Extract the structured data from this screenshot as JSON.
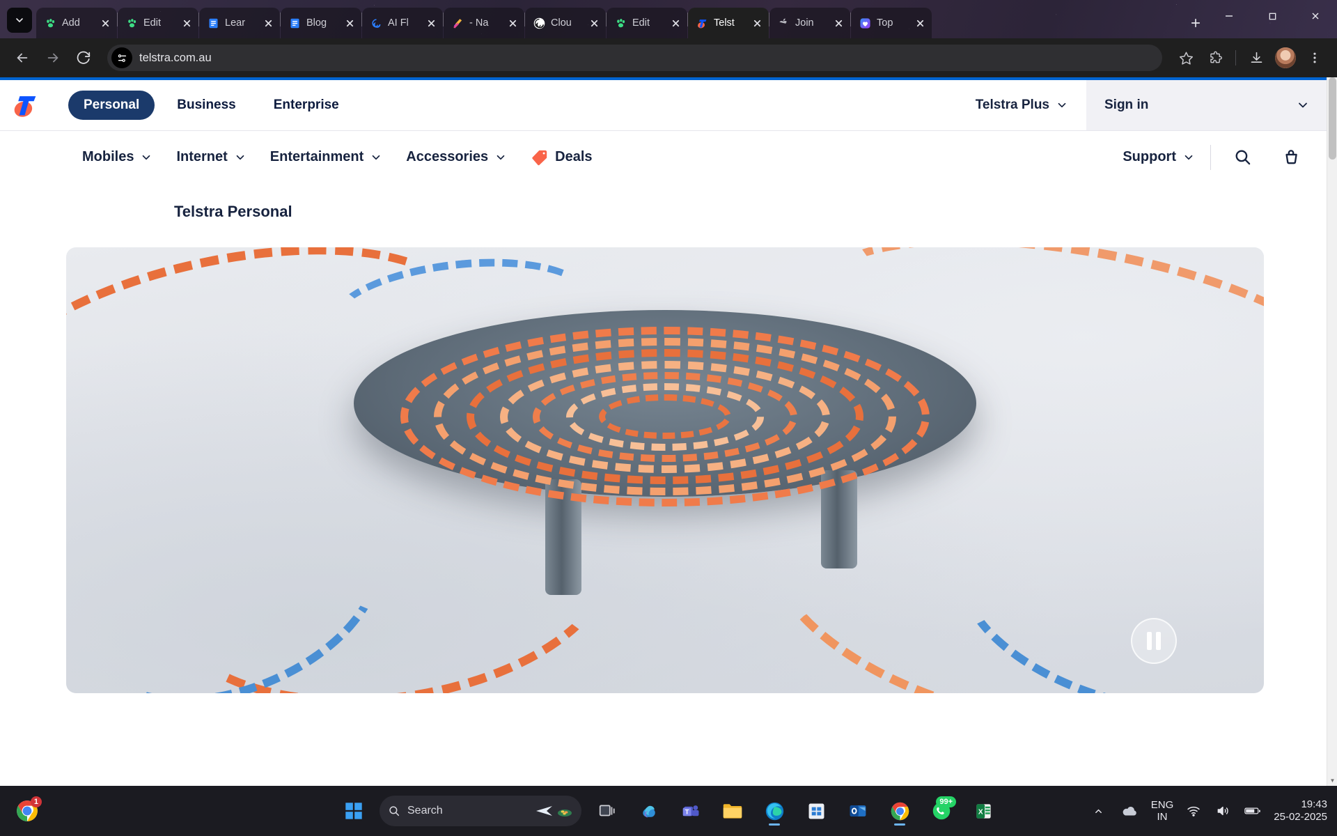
{
  "browser": {
    "tablist_icon": "chevron-down-icon",
    "tabs": [
      {
        "title": "Add",
        "favicon": "paw-green-icon",
        "active": false
      },
      {
        "title": "Edit",
        "favicon": "paw-green-icon",
        "active": false
      },
      {
        "title": "Lear",
        "favicon": "docs-blue-icon",
        "active": false
      },
      {
        "title": "Blog",
        "favicon": "docs-blue-icon",
        "active": false
      },
      {
        "title": "AI Fl",
        "favicon": "spiral-blue-icon",
        "active": false
      },
      {
        "title": "- Na",
        "favicon": "ribbon-icon",
        "active": false
      },
      {
        "title": "Clou",
        "favicon": "openai-icon",
        "active": false
      },
      {
        "title": "Edit",
        "favicon": "paw-green-icon",
        "active": false
      },
      {
        "title": "Telst",
        "favicon": "telstra-icon",
        "active": true
      },
      {
        "title": "Join",
        "favicon": "apple-icon",
        "active": false
      },
      {
        "title": "Top",
        "favicon": "heart-purple-icon",
        "active": false
      }
    ],
    "new_tab_label": "+",
    "window_controls": {
      "minimize": "—",
      "maximize": "▢",
      "close": "✕"
    },
    "toolbar": {
      "back": "←",
      "forward": "→",
      "reload": "⟳",
      "url": "telstra.com.au",
      "site_info_icon": "site-settings-icon",
      "bookmark_icon": "star-icon",
      "extensions_icon": "puzzle-icon",
      "downloads_icon": "download-icon",
      "profile_icon": "avatar-icon",
      "menu_icon": "three-dot-menu-icon"
    }
  },
  "site": {
    "brand_logo": "telstra-logo",
    "accent_blue": "#0064d2",
    "navy": "#17233f",
    "orange": "#f96449",
    "top_links": [
      {
        "label": "Personal",
        "active": true
      },
      {
        "label": "Business",
        "active": false
      },
      {
        "label": "Enterprise",
        "active": false
      }
    ],
    "telstra_plus": "Telstra Plus",
    "sign_in": "Sign in",
    "nav_items": [
      {
        "label": "Mobiles",
        "has_chevron": true,
        "has_tag": false
      },
      {
        "label": "Internet",
        "has_chevron": true,
        "has_tag": false
      },
      {
        "label": "Entertainment",
        "has_chevron": true,
        "has_tag": false
      },
      {
        "label": "Accessories",
        "has_chevron": true,
        "has_tag": false
      },
      {
        "label": "Deals",
        "has_chevron": false,
        "has_tag": true
      }
    ],
    "support_label": "Support",
    "search_icon": "search-icon",
    "cart_icon": "cart-icon",
    "breadcrumb": "Telstra Personal",
    "hero": {
      "media_type": "video",
      "description": "Domino art installation with orange and blue dominoes arranged in spirals around a glass table",
      "pause_button_label": "Pause"
    }
  },
  "taskbar": {
    "start_label": "Start",
    "search_placeholder": "Search",
    "items": [
      {
        "name": "task-view",
        "label": "Task view"
      },
      {
        "name": "copilot",
        "label": "Copilot"
      },
      {
        "name": "teams",
        "label": "Microsoft Teams"
      },
      {
        "name": "file-explorer",
        "label": "File Explorer"
      },
      {
        "name": "edge",
        "label": "Microsoft Edge"
      },
      {
        "name": "microsoft-store",
        "label": "Microsoft Store"
      },
      {
        "name": "outlook",
        "label": "Outlook"
      },
      {
        "name": "chrome",
        "label": "Google Chrome"
      },
      {
        "name": "whatsapp",
        "label": "WhatsApp",
        "badge": "99+"
      },
      {
        "name": "excel",
        "label": "Excel"
      }
    ],
    "pinned_badge": "1",
    "tray": {
      "overflow_icon": "chevron-up-icon",
      "cloud_icon": "onedrive-icon",
      "language": "ENG\nIN",
      "language_line1": "ENG",
      "language_line2": "IN",
      "wifi_icon": "wifi-icon",
      "volume_icon": "volume-icon",
      "battery_icon": "battery-icon",
      "time": "19:43",
      "date": "25-02-2025"
    }
  }
}
